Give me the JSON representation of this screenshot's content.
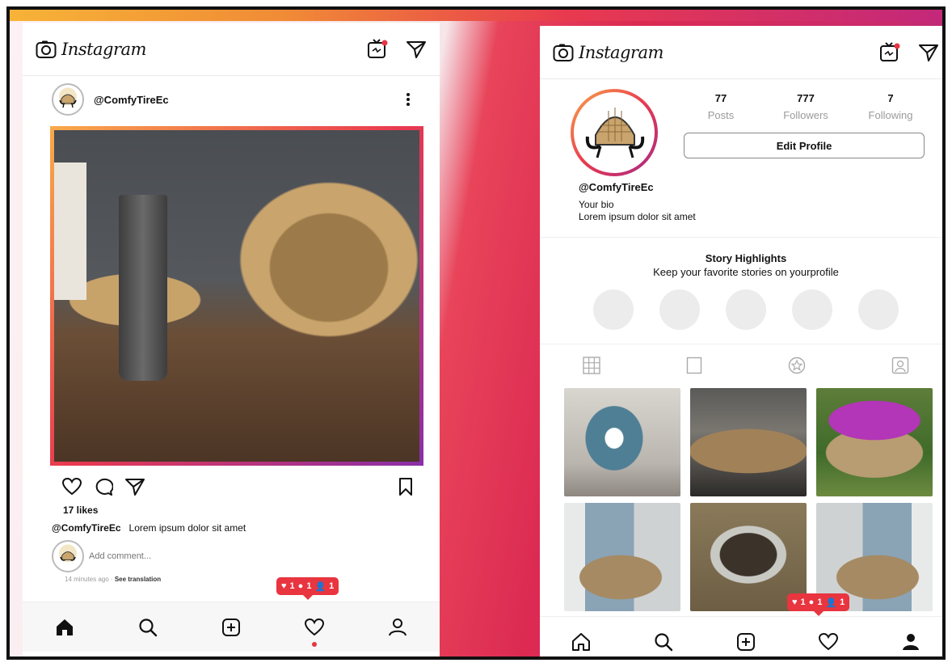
{
  "app": {
    "name": "Instagram"
  },
  "feed": {
    "post": {
      "username": "@ComfyTireEc",
      "likes": "17 likes",
      "caption_user": "@ComfyTireEc",
      "caption_text": "Lorem ipsum dolor sit amet",
      "comment_placeholder": "Add comment...",
      "time": "14 minutes ago",
      "translation": "See translation"
    },
    "notifications": {
      "likes": "1",
      "comments": "1",
      "followers": "1"
    }
  },
  "profile": {
    "posts_count": "77",
    "posts_label": "Posts",
    "followers_count": "777",
    "followers_label": "Followers",
    "following_count": "7",
    "following_label": "Following",
    "edit_label": "Edit Profile",
    "username": "@ComfyTireEc",
    "bio_title": "Your bio",
    "bio_text": "Lorem ipsum dolor sit amet",
    "highlights_title": "Story Highlights",
    "highlights_sub": "Keep your favorite stories on yourprofile",
    "notifications": {
      "likes": "1",
      "comments": "1",
      "followers": "1"
    }
  },
  "icons": {
    "camera": "camera-icon",
    "igtv": "igtv-icon",
    "direct": "send-icon",
    "home": "home-icon",
    "search": "search-icon",
    "add": "add-post-icon",
    "activity": "heart-icon",
    "profile": "profile-icon"
  },
  "colors": {
    "accent": "#e8353f",
    "gradient_start": "#f8a94a",
    "gradient_end": "#a72a86"
  }
}
